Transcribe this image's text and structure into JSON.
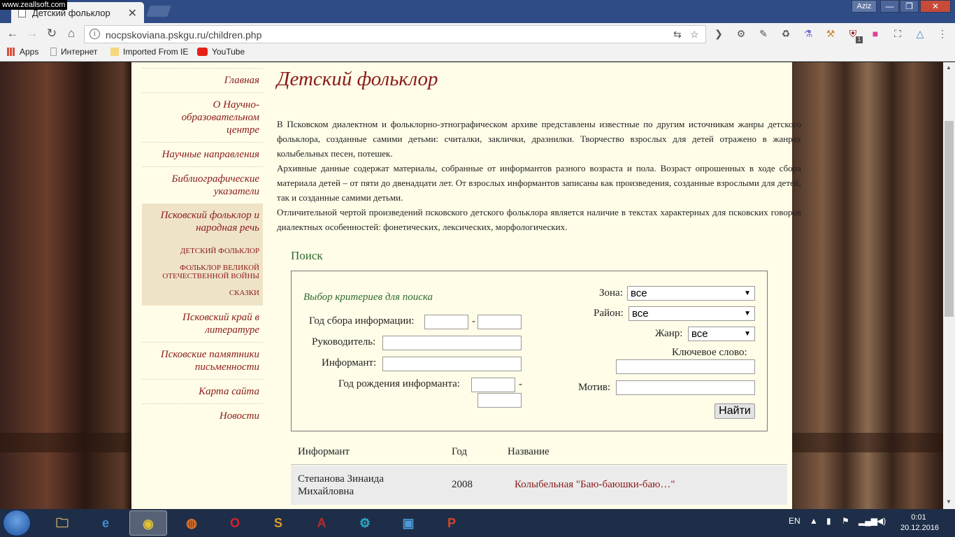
{
  "watermark": "www.zeallsoft.com",
  "browser": {
    "tab_title": "Детский фольклор",
    "tab_close": "✕",
    "profile": "Aziz",
    "window_controls": {
      "minimize": "—",
      "maximize": "❐",
      "close": "✕"
    },
    "url": "nocpskoviana.pskgu.ru/children.php",
    "nav": {
      "back": "←",
      "forward": "→",
      "reload": "↻",
      "home": "⌂"
    },
    "omnibox_icons": [
      "translate-icon",
      "star-icon"
    ],
    "extensions": [
      "pocket-icon",
      "gear-icon",
      "eyedropper-icon",
      "recycle-icon",
      "flask-icon",
      "hammer-icon",
      "ublock-icon",
      "color-icon",
      "screenshot-icon",
      "sync-icon"
    ],
    "ublock_count": "1",
    "menu": "⋮",
    "bookmarks": [
      {
        "label": "Apps",
        "icon": "apps-icon",
        "color": "#d94f3d"
      },
      {
        "label": "Интернет",
        "icon": "page-icon",
        "color": "#9e9e9e"
      },
      {
        "label": "Imported From IE",
        "icon": "folder-icon",
        "color": "#f6d77a"
      },
      {
        "label": "YouTube",
        "icon": "youtube-icon",
        "color": "#e62117"
      }
    ]
  },
  "sidebar": {
    "items": [
      {
        "label": "Главная"
      },
      {
        "label": "О Научно-образовательном центре"
      },
      {
        "label": "Научные направления"
      },
      {
        "label": "Библиографические указатели"
      },
      {
        "label": "Псковский фольклор и народная речь"
      },
      {
        "label": "Псковский край в литературе"
      },
      {
        "label": "Псковские памятники письменности"
      },
      {
        "label": "Карта сайта"
      },
      {
        "label": "Новости"
      }
    ],
    "subitems": [
      {
        "label": "Детский фольклор"
      },
      {
        "label": "Фольклор Великой Отечественной войны"
      },
      {
        "label": "Сказки"
      }
    ]
  },
  "main": {
    "title": "Детский фольклор",
    "paragraphs": [
      "В Псковском диалектном и фольклорно-этнографическом архиве представлены известные по другим источникам жанры детского фольклора, созданные самими детьми: считалки, заклички, дразнилки. Творчество взрослых для детей отражено в жанрах колыбельных песен, потешек.",
      "Архивные данные содержат материалы, собранные от информантов разного возраста и пола. Возраст опрошенных в ходе сбора материала детей – от пяти до двенадцати лет. От взрослых информантов записаны как произведения, созданные взрослыми для детей, так и созданные самими детьми.",
      "Отличительной чертой произведений псковского детского фольклора является наличие в текстах характерных для псковских говоров диалектных особенностей: фонетических, лексических, морфологических."
    ]
  },
  "search": {
    "title": "Поиск",
    "criteria_title": "Выбор критериев для поиска",
    "year_label": "Год сбора информации:",
    "leader_label": "Руководитель:",
    "informant_label": "Информант:",
    "birth_label": "Год рождения информанта:",
    "dash": "-",
    "zone_label": "Зона:",
    "zone_value": "все",
    "district_label": "Район:",
    "district_value": "все",
    "genre_label": "Жанр:",
    "genre_value": "все",
    "keyword_label": "Ключевое слово:",
    "motif_label": "Мотив:",
    "submit": "Найти",
    "arrow": "▼"
  },
  "results": {
    "columns": [
      "Информант",
      "Год",
      "Название"
    ],
    "rows": [
      {
        "informant": "Степанова Зинаида Михайловна",
        "year": "2008",
        "title": "Колыбельная \"Баю-баюшки-баю…\""
      }
    ]
  },
  "taskbar": {
    "apps": [
      {
        "name": "explorer-app",
        "glyph": "🗀",
        "color": "#e8c26a"
      },
      {
        "name": "ie-app",
        "glyph": "e",
        "color": "#3b8fd9"
      },
      {
        "name": "chrome-app",
        "glyph": "◉",
        "color": "#e2c13a"
      },
      {
        "name": "firefox-app",
        "glyph": "◍",
        "color": "#e8742a"
      },
      {
        "name": "opera-app",
        "glyph": "O",
        "color": "#d8202f"
      },
      {
        "name": "sublime-app",
        "glyph": "S",
        "color": "#e09a2a"
      },
      {
        "name": "access-app",
        "glyph": "A",
        "color": "#b22d2d"
      },
      {
        "name": "settings-app",
        "glyph": "⚙",
        "color": "#2fa7c9"
      },
      {
        "name": "window-app",
        "glyph": "▣",
        "color": "#4a9ad9"
      },
      {
        "name": "powerpoint-app",
        "glyph": "P",
        "color": "#d24726"
      }
    ],
    "language": "EN",
    "time": "0:01",
    "date": "20.12.2016"
  }
}
